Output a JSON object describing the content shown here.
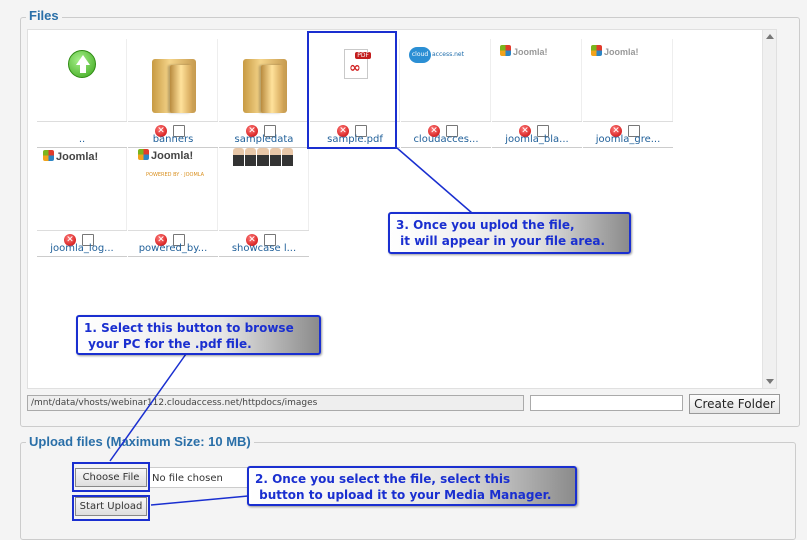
{
  "files_legend": "Files",
  "upload_legend": "Upload files (Maximum Size: 10 MB)",
  "files": [
    {
      "name": "..",
      "kind": "up",
      "deletable": false
    },
    {
      "name": "banners",
      "kind": "folder",
      "deletable": true
    },
    {
      "name": "sampledata",
      "kind": "folder",
      "deletable": true
    },
    {
      "name": "sample.pdf",
      "kind": "pdf",
      "deletable": true
    },
    {
      "name": "cloudacces...",
      "kind": "cloud",
      "deletable": true
    },
    {
      "name": "joomla_bla...",
      "kind": "joomla-small",
      "deletable": true
    },
    {
      "name": "joomla_gre...",
      "kind": "joomla-small",
      "deletable": true
    },
    {
      "name": "joomla_log...",
      "kind": "joomla",
      "deletable": true
    },
    {
      "name": "powered_by...",
      "kind": "joomla-powered",
      "deletable": true
    },
    {
      "name": "showcase l...",
      "kind": "people",
      "deletable": true
    }
  ],
  "logos": {
    "joomla": "Joomla!",
    "powered_sub": "POWERED BY · JOOMLA",
    "cloud_blob": "cloud",
    "cloud_text": "access.net",
    "pdf_tag": "PDF"
  },
  "path": "/mnt/data/vhosts/webinar112.cloudaccess.net/httpdocs/images",
  "folder_input_value": "",
  "create_folder_label": "Create Folder",
  "choose_file_label": "Choose File",
  "no_file_text": "No file chosen",
  "start_upload_label": "Start Upload",
  "callouts": {
    "step1": "1. Select this button to browse\n your PC for the .pdf file.",
    "step2": "2. Once you select the file, select this\n button to upload it to your Media Manager.",
    "step3": "3. Once you uplod the file,\n it will appear in your file area."
  },
  "colors": {
    "accent": "#1a2fd0",
    "legend": "#2a6fa8",
    "link": "#1f5f99"
  }
}
